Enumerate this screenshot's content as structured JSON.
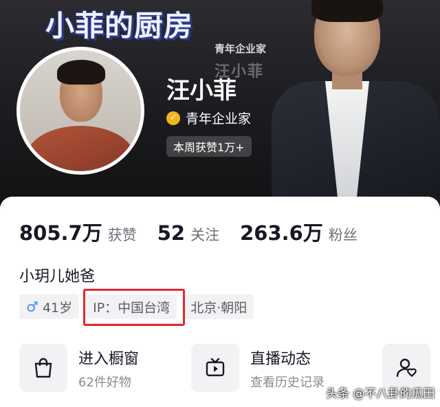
{
  "banner": {
    "title": "小菲的厨房",
    "subtitle": "青年企业家",
    "name_ghost": "汪小菲"
  },
  "profile": {
    "name": "汪小菲",
    "verify_label": "青年企业家",
    "weekly_likes": "本周获赞1万+",
    "verify_color": "#f4b41a"
  },
  "stats": [
    {
      "value": "805.7万",
      "label": "获赞"
    },
    {
      "value": "52",
      "label": "关注"
    },
    {
      "value": "263.6万",
      "label": "粉丝"
    }
  ],
  "bio": "小玥儿她爸",
  "tags": {
    "gender_icon": "♂",
    "age": "41岁",
    "ip": "IP：中国台湾",
    "location": "北京·朝阳"
  },
  "highlight_color": "#e3262b",
  "features": [
    {
      "title": "进入橱窗",
      "subtitle": "62件好物",
      "icon": "shopping-bag-icon"
    },
    {
      "title": "直播动态",
      "subtitle": "查看历史记录",
      "icon": "tv-icon"
    }
  ],
  "friend_icon": "user-heart-icon",
  "watermark": "头条 @不八卦的瓜田"
}
